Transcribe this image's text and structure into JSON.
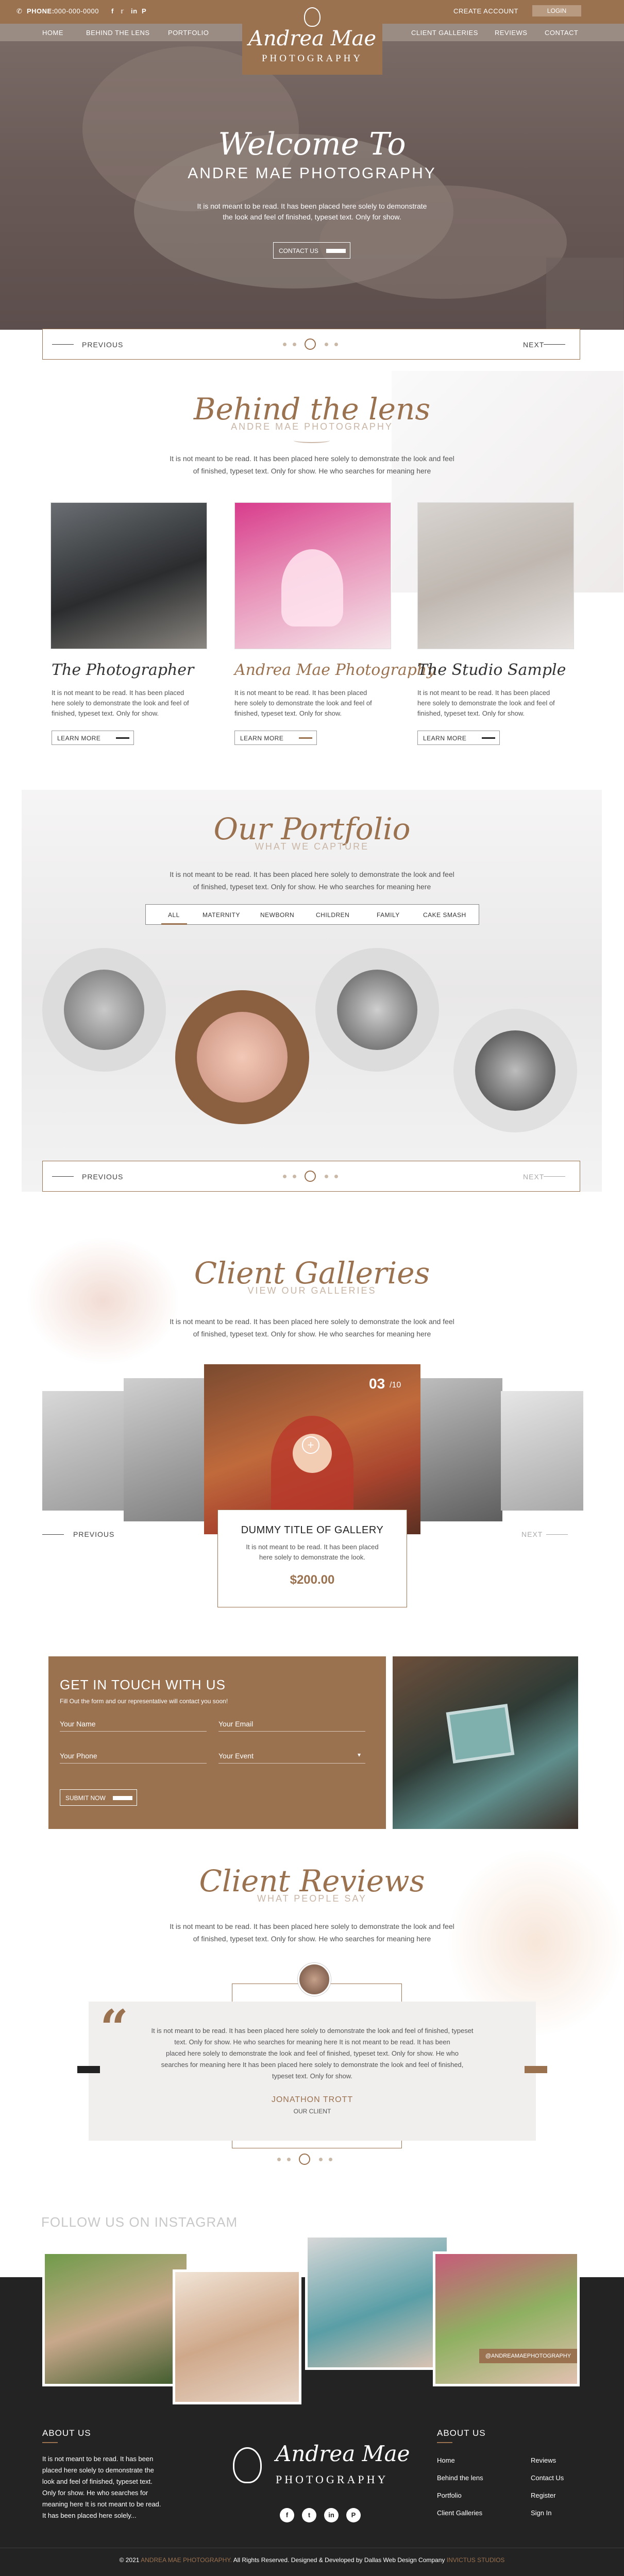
{
  "topbar": {
    "phone_label": "PHONE:",
    "phone": "000-000-0000",
    "social_icons": [
      "facebook-icon",
      "twitter-icon",
      "linkedin-icon",
      "pinterest-icon"
    ],
    "create_account": "CREATE ACCOUNT",
    "login": "LOGIN"
  },
  "logo": {
    "script": "Andrea Mae",
    "word": "PHOTOGRAPHY"
  },
  "nav": {
    "left": [
      "HOME",
      "BEHIND THE LENS",
      "PORTFOLIO"
    ],
    "right": [
      "CLIENT GALLERIES",
      "REVIEWS",
      "CONTACT"
    ]
  },
  "hero": {
    "script": "Welcome To",
    "title": "ANDRE MAE PHOTOGRAPHY",
    "text_line1": "It is not meant to be read. It has been placed here solely to demonstrate",
    "text_line2": "the look and feel of finished, typeset text. Only for show.",
    "button": "CONTACT US"
  },
  "pager1": {
    "prev": "PREVIOUS",
    "next": "NEXT"
  },
  "lens": {
    "title": "Behind the lens",
    "subtitle": "ANDRE MAE PHOTOGRAPHY",
    "text_line1": "It is not meant to be read. It has been placed here solely to demonstrate the look and feel",
    "text_line2": "of finished, typeset text. Only for show. He who searches for meaning here",
    "cards": [
      {
        "title": "The Photographer",
        "l1": "It is not meant to be read. It has been placed",
        "l2": "here solely to demonstrate the look and feel of",
        "l3": "finished, typeset text. Only for show.",
        "btn": "LEARN MORE"
      },
      {
        "title": "Andrea Mae Photography",
        "l1": "It is not meant to be read. It has been placed",
        "l2": "here solely to demonstrate the look and feel of",
        "l3": "finished, typeset text. Only for show.",
        "btn": "LEARN MORE"
      },
      {
        "title": "The Studio Sample",
        "l1": "It is not meant to be read. It has been placed",
        "l2": "here solely to demonstrate the look and feel of",
        "l3": "finished, typeset text. Only for show.",
        "btn": "LEARN MORE"
      }
    ]
  },
  "portfolio": {
    "title": "Our Portfolio",
    "subtitle": "WHAT WE CAPTURE",
    "text_line1": "It is not meant to be read. It has been placed here solely to demonstrate the look and feel",
    "text_line2": "of finished, typeset text. Only for show. He who searches for meaning here",
    "tabs": [
      "ALL",
      "MATERNITY",
      "NEWBORN",
      "CHILDREN",
      "FAMILY",
      "CAKE SMASH"
    ],
    "prev": "PREVIOUS",
    "next": "NEXT"
  },
  "galleries": {
    "title": "Client Galleries",
    "subtitle": "VIEW OUR GALLERIES",
    "text_line1": "It is not meant to be read. It has been placed here solely to demonstrate the look and feel",
    "text_line2": "of finished, typeset text. Only for show. He who searches for meaning here",
    "counter_current": "03",
    "counter_total": "/10",
    "prev": "PREVIOUS",
    "next": "NEXT",
    "card": {
      "title": "DUMMY TITLE OF GALLERY",
      "l1": "It is not meant to be read. It has been placed",
      "l2": "here solely to demonstrate the look.",
      "price": "$200.00"
    }
  },
  "contact": {
    "title": "GET IN TOUCH WITH US",
    "sub": "Fill Out the form and our representative will contact you soon!",
    "name": "Your Name",
    "email": "Your Email",
    "phone": "Your Phone",
    "event": "Your Event",
    "button": "SUBMIT NOW"
  },
  "reviews": {
    "title": "Client Reviews",
    "subtitle": "WHAT PEOPLE SAY",
    "text_line1": "It is not meant to be read. It has been placed here solely to demonstrate the look and feel",
    "text_line2": "of finished, typeset text. Only for show. He who searches for meaning here",
    "quote_l1": "It is not meant to be read. It has been placed here solely to demonstrate the look and feel of finished, typeset",
    "quote_l2": "text. Only for show. He who searches for meaning here It is not meant to be read. It has been",
    "quote_l3": "placed here solely to demonstrate the look and feel of finished, typeset text. Only for show. He who",
    "quote_l4": "searches for meaning here It has been placed here solely to demonstrate the look and feel of finished,",
    "quote_l5": "typeset text. Only for show.",
    "name": "JONATHON TROTT",
    "role": "OUR CLIENT"
  },
  "instagram": {
    "title": "FOLLOW US ON INSTAGRAM",
    "handle": "@ANDREAMAEPHOTOGRAPHY"
  },
  "footer": {
    "about_title": "ABOUT US",
    "about_l1": "It is not meant to be read. It has been",
    "about_l2": "placed here solely to demonstrate the",
    "about_l3": "look and feel of finished, typeset text.",
    "about_l4": "Only for show. He who searches for",
    "about_l5": "meaning here It is not meant to be read.",
    "about_l6": "It has been placed here solely...",
    "logo_script": "Andrea Mae",
    "logo_word": "PHOTOGRAPHY",
    "links_title": "ABOUT US",
    "links_col1": [
      "Home",
      "Behind the lens",
      "Portfolio",
      "Client Galleries"
    ],
    "links_col2": [
      "Reviews",
      "Contact Us",
      "Register",
      "Sign In"
    ],
    "copyright_pre": "© 2021",
    "copyright_brand": "ANDREA MAE PHOTOGRAPHY.",
    "copyright_mid": "All Rights Reserved. Designed & Developed by Dallas Web Design Company",
    "copyright_studio": "INVICTUS STUDIOS"
  },
  "colors": {
    "accent": "#9b7250",
    "dark": "#232323"
  }
}
